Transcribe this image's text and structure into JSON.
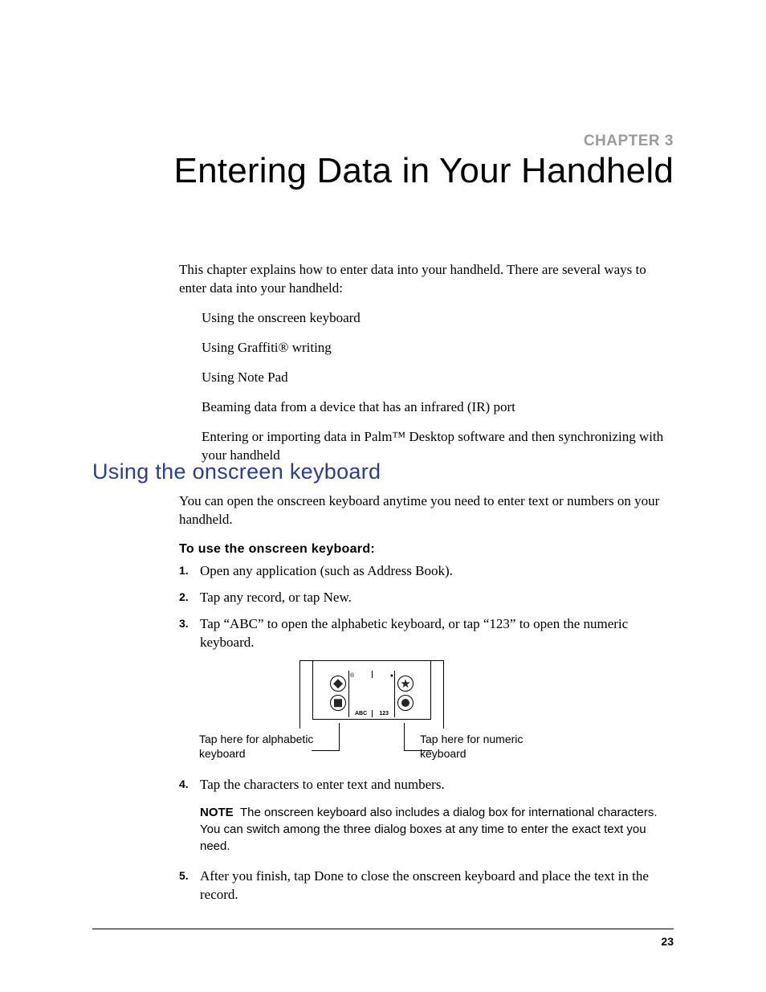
{
  "chapter_label": "CHAPTER 3",
  "chapter_title": "Entering Data in Your Handheld",
  "intro": "This chapter explains how to enter data into your handheld. There are several ways to enter data into your handheld:",
  "bullets": [
    "Using the onscreen keyboard",
    "Using Graffiti® writing",
    "Using Note Pad",
    "Beaming data from a device that has an infrared (IR) port",
    "Entering or importing data in Palm™ Desktop software and then synchronizing with your handheld"
  ],
  "section_heading": "Using the onscreen keyboard",
  "section_intro": "You can open the onscreen keyboard anytime you need to enter text or numbers on your handheld.",
  "subhead": "To use the onscreen keyboard:",
  "steps": {
    "s1": "Open any application (such as Address Book).",
    "s2": "Tap any record, or tap New.",
    "s3": "Tap “ABC” to open the alphabetic keyboard, or tap “123” to open the numeric keyboard.",
    "s4": "Tap the characters to enter text and numbers.",
    "s5": "After you finish, tap Done to close the onscreen keyboard and place the text in the record."
  },
  "figure": {
    "abc_label": "ABC",
    "num_label": "123",
    "callout_left": "Tap here for alphabetic keyboard",
    "callout_right": "Tap here for numeric keyboard"
  },
  "note_label": "NOTE",
  "note_text": "The onscreen keyboard also includes a dialog box for international characters. You can switch among the three dialog boxes at any time to enter the exact text you need.",
  "page_number": "23"
}
